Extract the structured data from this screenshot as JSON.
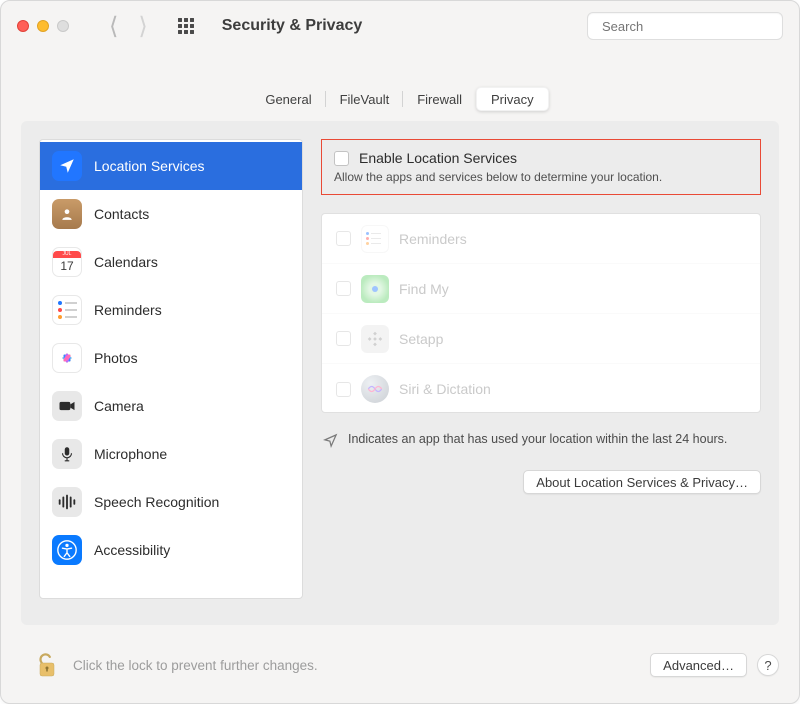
{
  "window": {
    "title": "Security & Privacy"
  },
  "search": {
    "placeholder": "Search"
  },
  "tabs": [
    {
      "label": "General"
    },
    {
      "label": "FileVault"
    },
    {
      "label": "Firewall"
    },
    {
      "label": "Privacy"
    }
  ],
  "activeTab": 3,
  "sidebar": {
    "items": [
      {
        "label": "Location Services",
        "selected": true
      },
      {
        "label": "Contacts"
      },
      {
        "label": "Calendars"
      },
      {
        "label": "Reminders"
      },
      {
        "label": "Photos"
      },
      {
        "label": "Camera"
      },
      {
        "label": "Microphone"
      },
      {
        "label": "Speech Recognition"
      },
      {
        "label": "Accessibility"
      }
    ],
    "calendarDay": "17"
  },
  "enable": {
    "label": "Enable Location Services",
    "subtitle": "Allow the apps and services below to determine your location."
  },
  "apps": [
    {
      "name": "Reminders"
    },
    {
      "name": "Find My"
    },
    {
      "name": "Setapp"
    },
    {
      "name": "Siri & Dictation"
    }
  ],
  "indicator": {
    "text": "Indicates an app that has used your location within the last 24 hours."
  },
  "buttons": {
    "about": "About Location Services & Privacy…",
    "advanced": "Advanced…",
    "help": "?"
  },
  "lock": {
    "text": "Click the lock to prevent further changes."
  }
}
